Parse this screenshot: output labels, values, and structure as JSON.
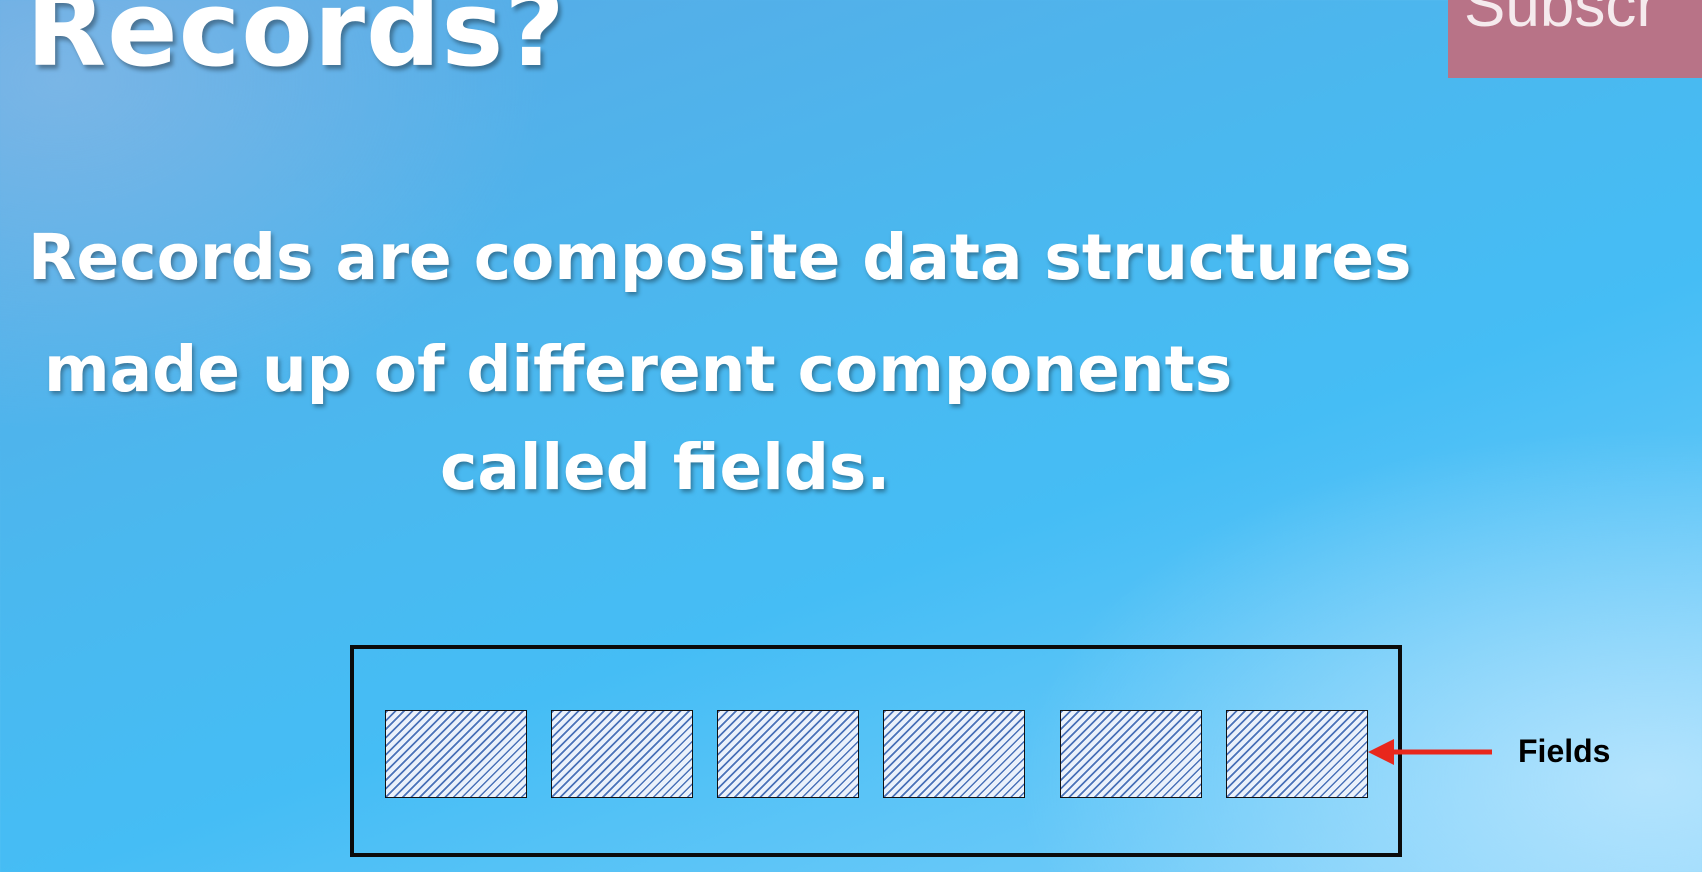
{
  "slide": {
    "title": "Records?",
    "definition_lines": [
      "Records are composite data structures",
      "made up of different components",
      "called fields."
    ]
  },
  "subscribe": {
    "label": "Subscr"
  },
  "diagram": {
    "field_count": 6,
    "fields_label": "Fields",
    "arrow_color": "#e8271c",
    "hatch_color": "#4a72b8"
  }
}
